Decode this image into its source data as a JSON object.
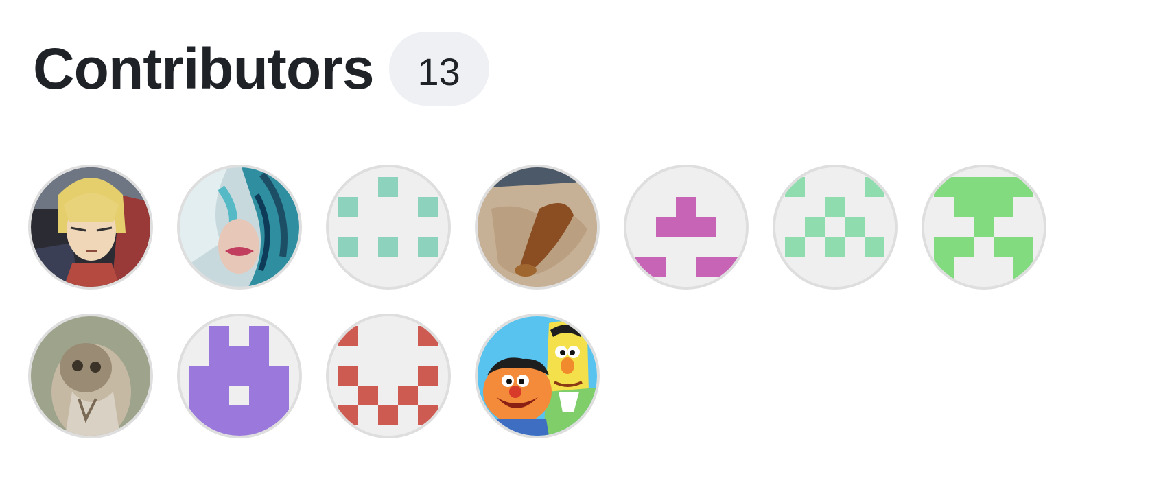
{
  "contributors": {
    "title": "Contributors",
    "count": "13"
  }
}
